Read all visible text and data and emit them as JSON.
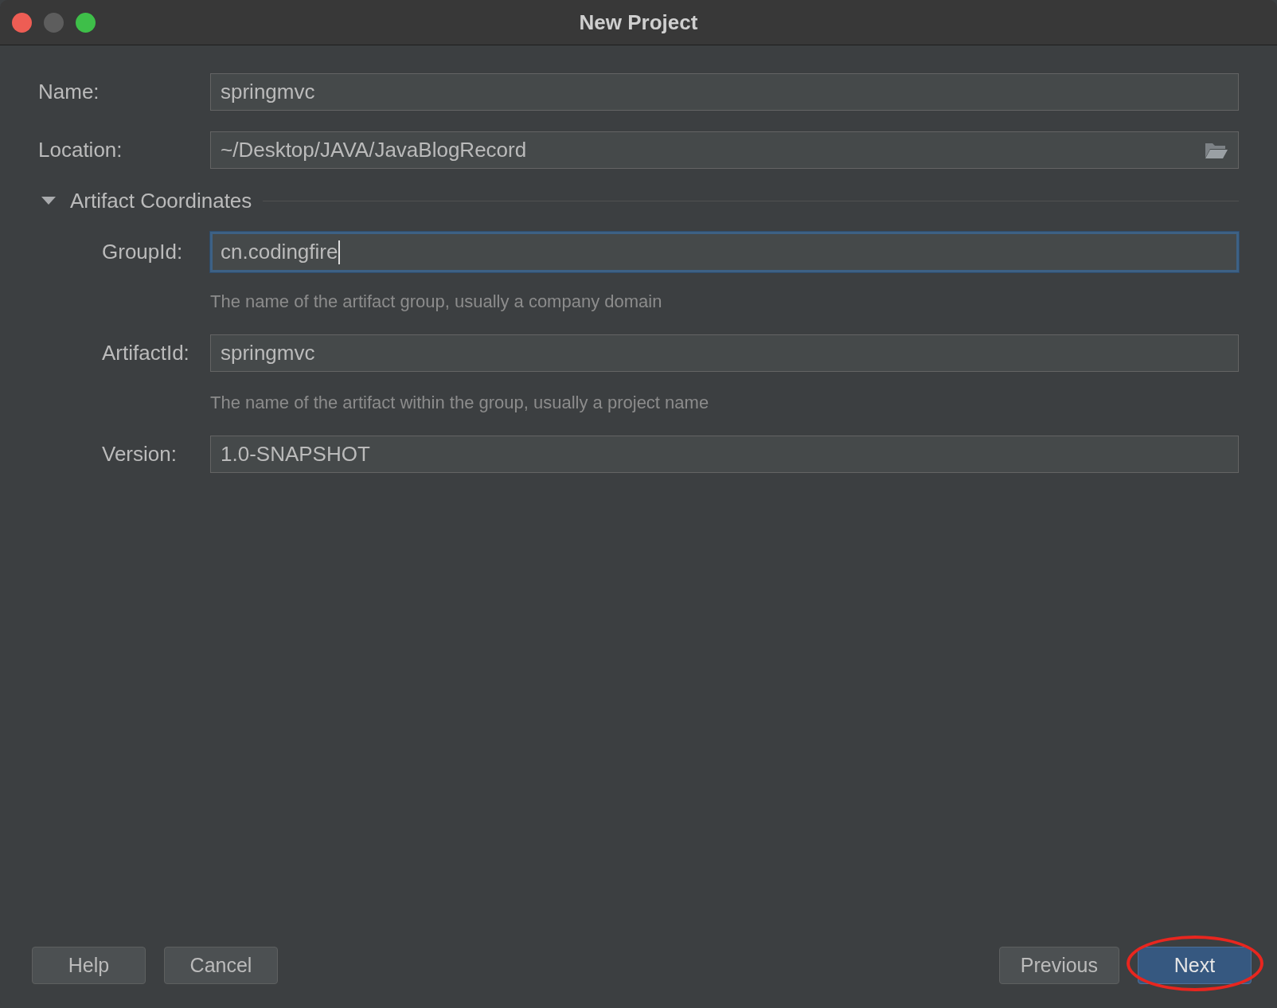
{
  "window": {
    "title": "New Project"
  },
  "fields": [
    {
      "label": "Name:",
      "value": "springmvc"
    },
    {
      "label": "Location:",
      "value": "~/Desktop/JAVA/JavaBlogRecord",
      "kind": "browse"
    }
  ],
  "artifact_coordinates": {
    "title": "Artifact Coordinates",
    "expanded": true,
    "fields": [
      {
        "label": "GroupId:",
        "value": "cn.codingfire",
        "focused": true,
        "hint": "The name of the artifact group, usually a company domain"
      },
      {
        "label": "ArtifactId:",
        "value": "springmvc",
        "focused": false,
        "hint": "The name of the artifact within the group, usually a project name"
      },
      {
        "label": "Version:",
        "value": "1.0-SNAPSHOT",
        "focused": false
      }
    ]
  },
  "left_buttons": [
    {
      "label": "Help",
      "primary": false,
      "circled": false
    },
    {
      "label": "Cancel",
      "primary": false,
      "circled": false
    }
  ],
  "right_buttons": [
    {
      "label": "Previous",
      "primary": false,
      "circled": false
    },
    {
      "label": "Next",
      "primary": true,
      "circled": true
    }
  ]
}
